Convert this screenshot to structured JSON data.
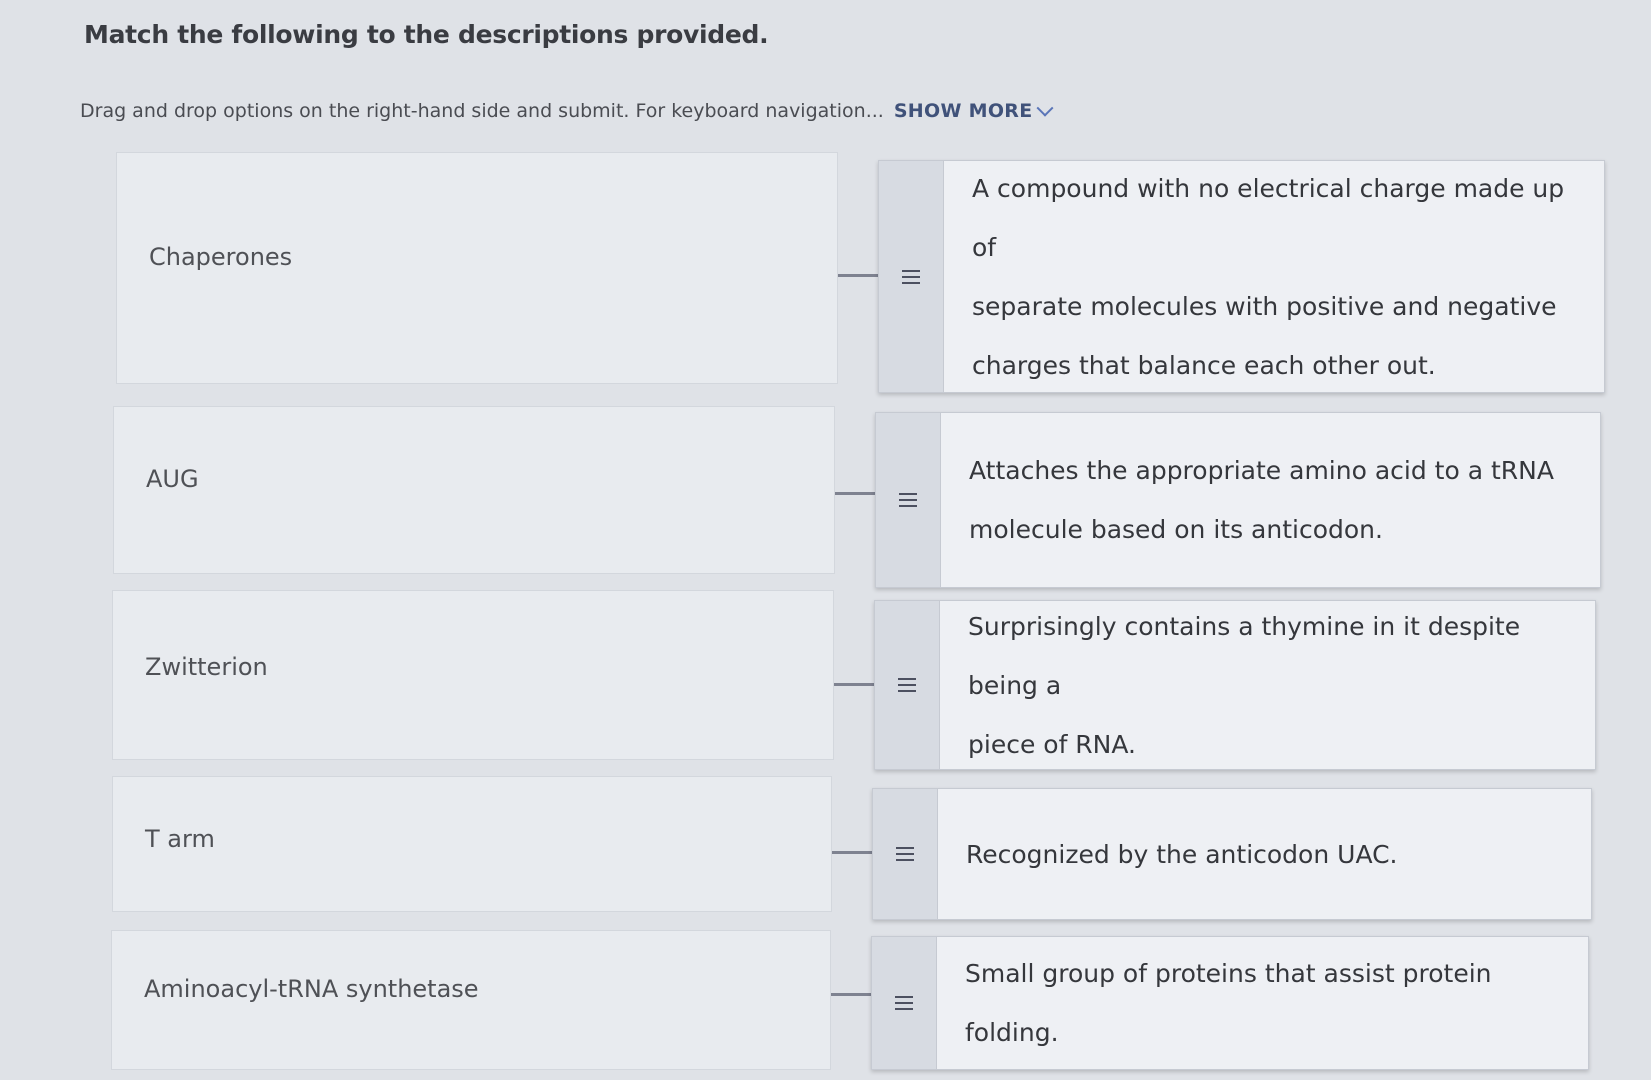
{
  "question": {
    "title": "Match the following to the descriptions provided."
  },
  "instructions": {
    "text": "Drag and drop options on the right-hand side and submit. For keyboard navigation...",
    "show_more_label": "SHOW MORE"
  },
  "pairs": [
    {
      "term": "Chaperones",
      "description": "A compound with no electrical charge made up of\nseparate molecules with positive and negative\ncharges that balance each other out."
    },
    {
      "term": "AUG",
      "description": "Attaches the appropriate amino acid to a tRNA\nmolecule based on its anticodon."
    },
    {
      "term": "Zwitterion",
      "description": "Surprisingly contains a thymine in it despite being a\npiece of RNA."
    },
    {
      "term": "T arm",
      "description": "Recognized by the anticodon UAC."
    },
    {
      "term": "Aminoacyl-tRNA synthetase",
      "description": "Small group of proteins that assist protein folding."
    }
  ]
}
